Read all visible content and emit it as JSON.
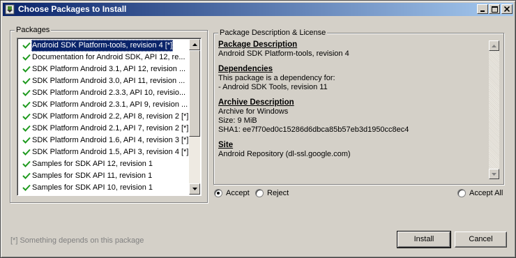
{
  "window": {
    "title": "Choose Packages to Install",
    "controls": {
      "minimize": "_",
      "maximize": "□",
      "close": "×"
    }
  },
  "packages": {
    "legend": "Packages",
    "items": [
      {
        "label": "Android SDK Platform-tools, revision 4 [*]",
        "selected": true
      },
      {
        "label": "Documentation for Android SDK, API 12, re...",
        "selected": false
      },
      {
        "label": "SDK Platform Android 3.1, API 12, revision ...",
        "selected": false
      },
      {
        "label": "SDK Platform Android 3.0, API 11, revision ...",
        "selected": false
      },
      {
        "label": "SDK Platform Android 2.3.3, API 10, revisio...",
        "selected": false
      },
      {
        "label": "SDK Platform Android 2.3.1, API 9, revision ...",
        "selected": false
      },
      {
        "label": "SDK Platform Android 2.2, API 8, revision 2 [*]",
        "selected": false
      },
      {
        "label": "SDK Platform Android 2.1, API 7, revision 2 [*]",
        "selected": false
      },
      {
        "label": "SDK Platform Android 1.6, API 4, revision 3 [*]",
        "selected": false
      },
      {
        "label": "SDK Platform Android 1.5, API 3, revision 4 [*]",
        "selected": false
      },
      {
        "label": "Samples for SDK API 12, revision 1",
        "selected": false
      },
      {
        "label": "Samples for SDK API 11, revision 1",
        "selected": false
      },
      {
        "label": "Samples for SDK API 10, revision 1",
        "selected": false
      }
    ],
    "check_color": "#1e9a1e"
  },
  "description": {
    "legend": "Package Description & License",
    "package_heading": "Package Description",
    "package_text": "Android SDK Platform-tools, revision 4",
    "dependencies_heading": "Dependencies",
    "dependencies_line1": "This package is a dependency for:",
    "dependencies_line2": "- Android SDK Tools, revision 11",
    "archive_heading": "Archive Description",
    "archive_line1": "Archive for Windows",
    "archive_line2": "Size: 9 MiB",
    "archive_line3": "SHA1: ee7f70ed0c15286d6dbca85b57eb3d1950cc8ec4",
    "site_heading": "Site",
    "site_text": "Android Repository (dl-ssl.google.com)"
  },
  "options": {
    "accept_label": "Accept",
    "accept_selected": true,
    "reject_label": "Reject",
    "accept_all_label": "Accept All"
  },
  "footer": {
    "note": "[*] Something depends on this package",
    "install_label": "Install",
    "cancel_label": "Cancel"
  }
}
